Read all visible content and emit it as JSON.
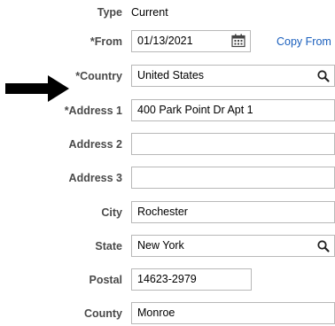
{
  "form": {
    "type": {
      "label": "Type",
      "value": "Current"
    },
    "from": {
      "label": "*From",
      "value": "01/13/2021",
      "link": "Copy From"
    },
    "country": {
      "label": "*Country",
      "value": "United States"
    },
    "address1": {
      "label": "*Address 1",
      "value": "400 Park Point Dr Apt 1"
    },
    "address2": {
      "label": "Address 2",
      "value": ""
    },
    "address3": {
      "label": "Address 3",
      "value": ""
    },
    "city": {
      "label": "City",
      "value": "Rochester"
    },
    "state": {
      "label": "State",
      "value": "New York"
    },
    "postal": {
      "label": "Postal",
      "value": "14623-2979"
    },
    "county": {
      "label": "County",
      "value": "Monroe"
    }
  },
  "icons": {
    "arrow": "arrow-right-icon",
    "calendar": "calendar-icon",
    "search": "search-icon"
  },
  "colors": {
    "link": "#1a5fbd",
    "label": "#4a4a4a",
    "border": "#b8b8b8"
  }
}
